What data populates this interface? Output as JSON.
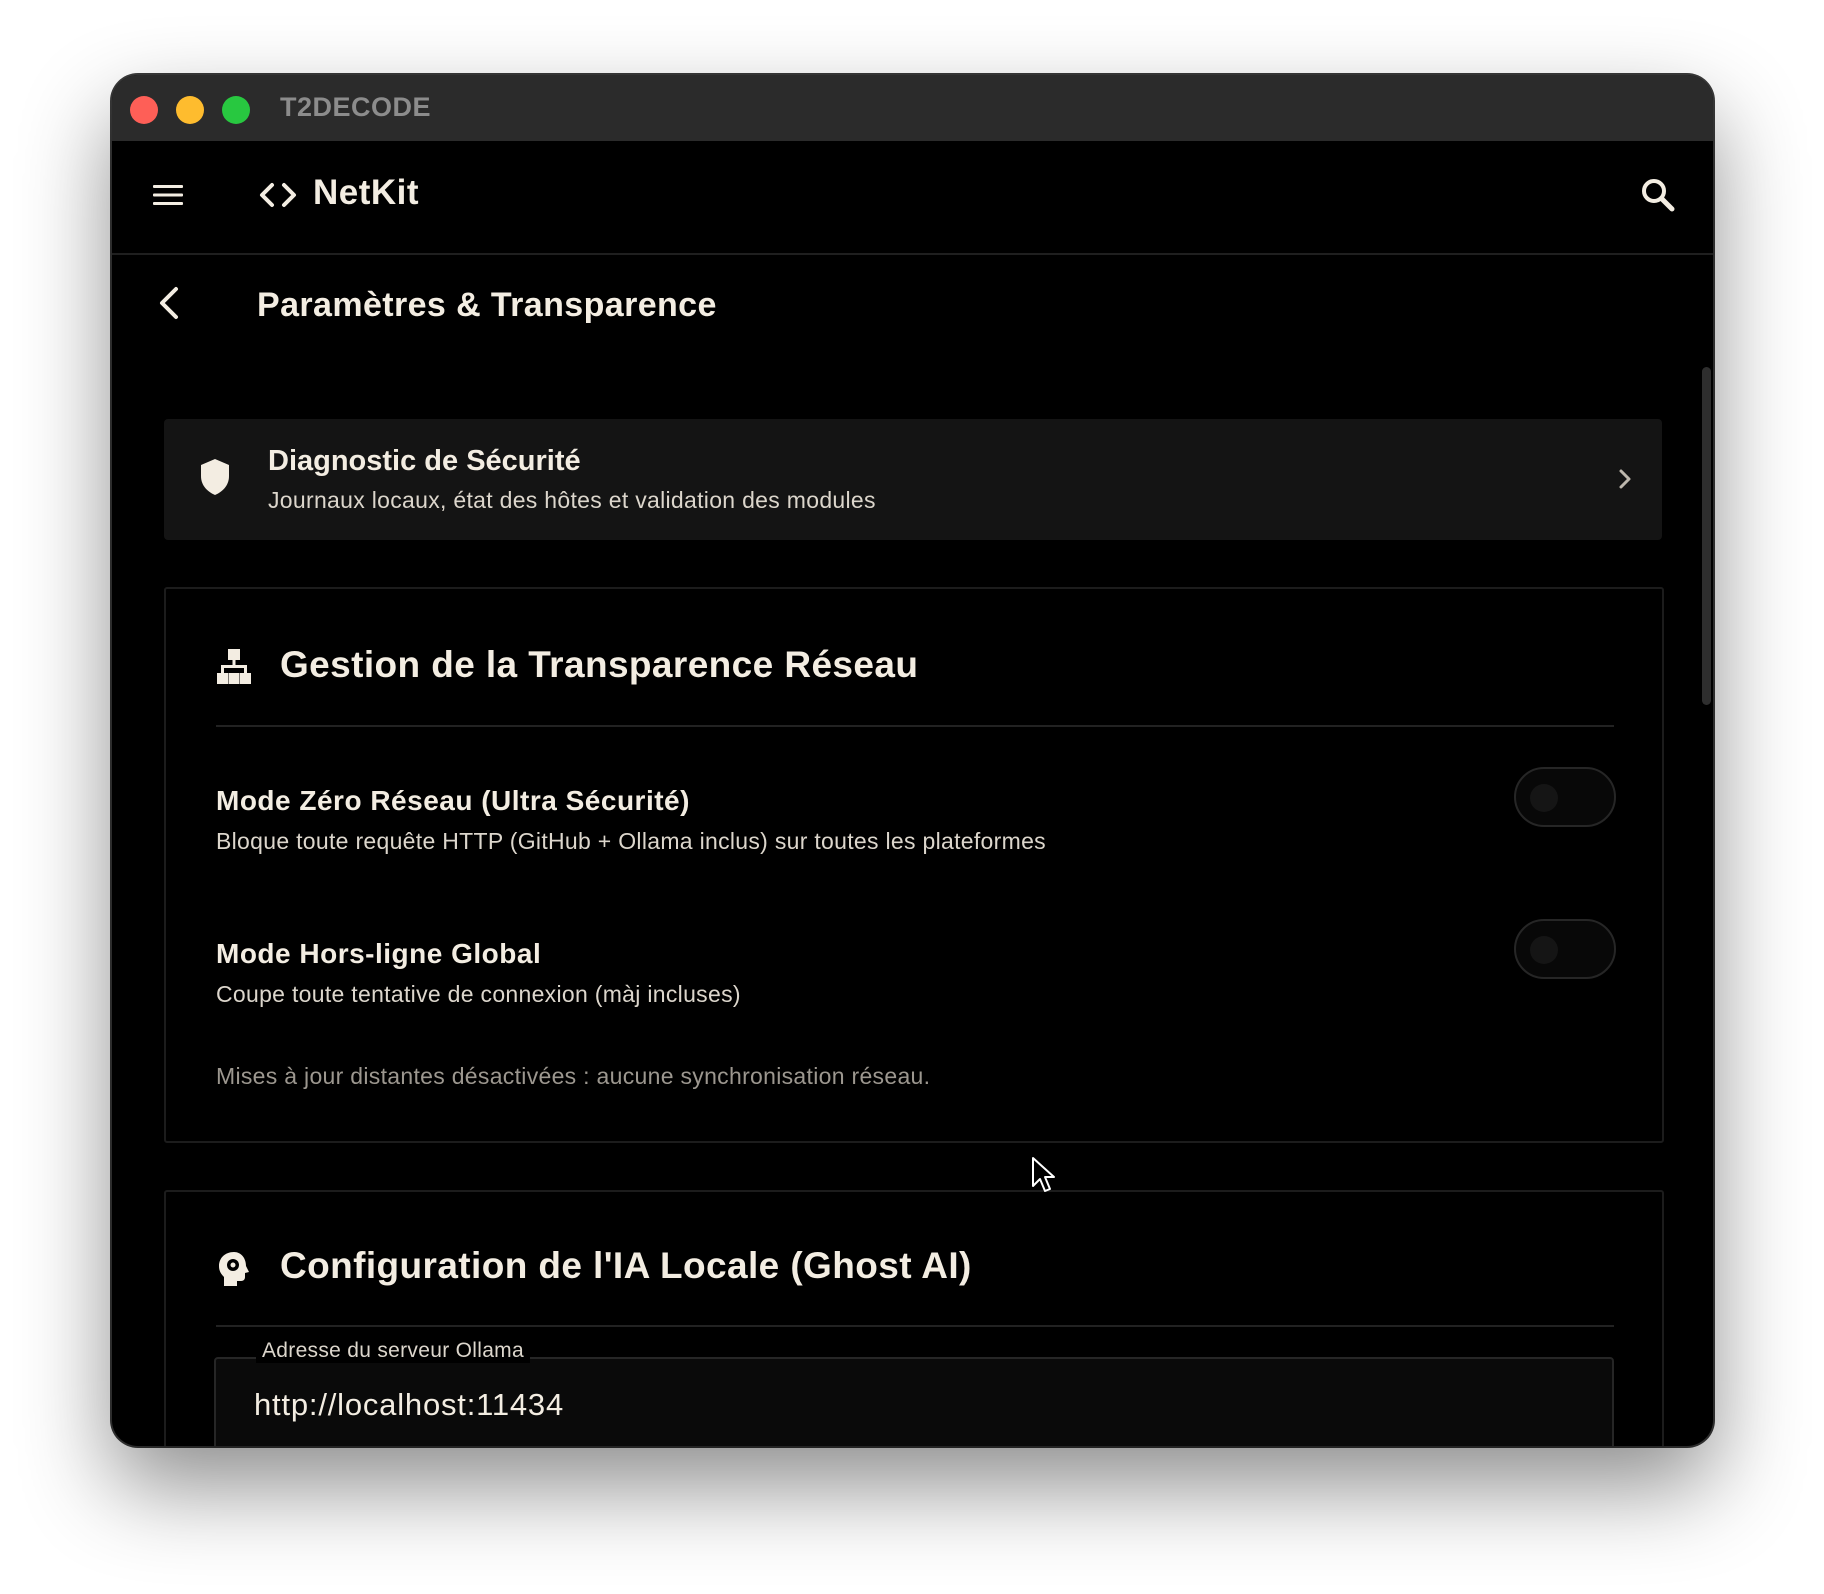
{
  "window": {
    "title": "T2DECODE"
  },
  "app": {
    "name": "NetKit"
  },
  "icons": {
    "menu": "hamburger-menu-icon",
    "logo": "code-brackets-icon",
    "search": "search-icon",
    "back": "chevron-left-icon",
    "diagnostic": "shield-icon",
    "diagnostic_arrow": "chevron-right-icon",
    "network": "network-hierarchy-icon",
    "ai": "head-gear-icon"
  },
  "page": {
    "title": "Paramètres & Transparence"
  },
  "diagnostic": {
    "title": "Diagnostic de Sécurité",
    "subtitle": "Journaux locaux, état des hôtes et validation des modules"
  },
  "network_section": {
    "title": "Gestion de la Transparence Réseau",
    "settings": [
      {
        "title": "Mode Zéro Réseau (Ultra Sécurité)",
        "description": "Bloque toute requête HTTP (GitHub + Ollama inclus) sur toutes les plateformes",
        "enabled": false
      },
      {
        "title": "Mode Hors-ligne Global",
        "description": "Coupe toute tentative de connexion (màj incluses)",
        "enabled": false
      }
    ],
    "note": "Mises à jour distantes désactivées : aucune synchronisation réseau."
  },
  "ai_section": {
    "title": "Configuration de l'IA Locale (Ghost AI)",
    "server_field": {
      "label": "Adresse du serveur Ollama",
      "value": "http://localhost:11434"
    }
  },
  "colors": {
    "background": "#000000",
    "text_primary": "#f3ede2",
    "text_secondary": "#dcd6cc",
    "text_muted": "#9c978f",
    "card": "#141414",
    "titlebar": "#2b2b2b"
  }
}
